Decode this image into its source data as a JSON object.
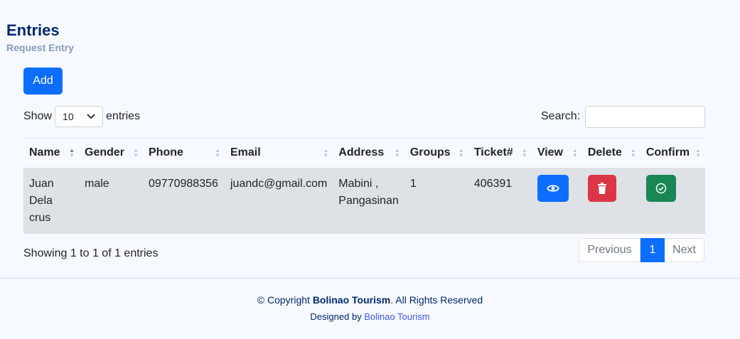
{
  "page": {
    "title": "Entries",
    "subtitle": "Request Entry"
  },
  "toolbar": {
    "add_label": "Add"
  },
  "length_control": {
    "prefix": "Show",
    "value": "10",
    "suffix": "entries"
  },
  "search": {
    "label": "Search:",
    "value": ""
  },
  "table": {
    "headers": [
      "Name",
      "Gender",
      "Phone",
      "Email",
      "Address",
      "Groups",
      "Ticket#",
      "View",
      "Delete",
      "Confirm"
    ],
    "rows": [
      {
        "name": "Juan Dela crus",
        "gender": "male",
        "phone": "09770988356",
        "email": "juandc@gmail.com",
        "address": "Mabini , Pangasinan",
        "groups": "1",
        "ticket": "406391"
      }
    ]
  },
  "info": "Showing 1 to 1 of 1 entries",
  "pagination": {
    "previous": "Previous",
    "current": "1",
    "next": "Next"
  },
  "footer": {
    "copyright_prefix": "© Copyright ",
    "brand": "Bolinao Tourism",
    "copyright_suffix": ". All Rights Reserved",
    "designed_by": "Designed by ",
    "designer": "Bolinao Tourism"
  },
  "colors": {
    "primary": "#0d6efd",
    "danger": "#dc3545",
    "success": "#198754",
    "title": "#012970"
  }
}
